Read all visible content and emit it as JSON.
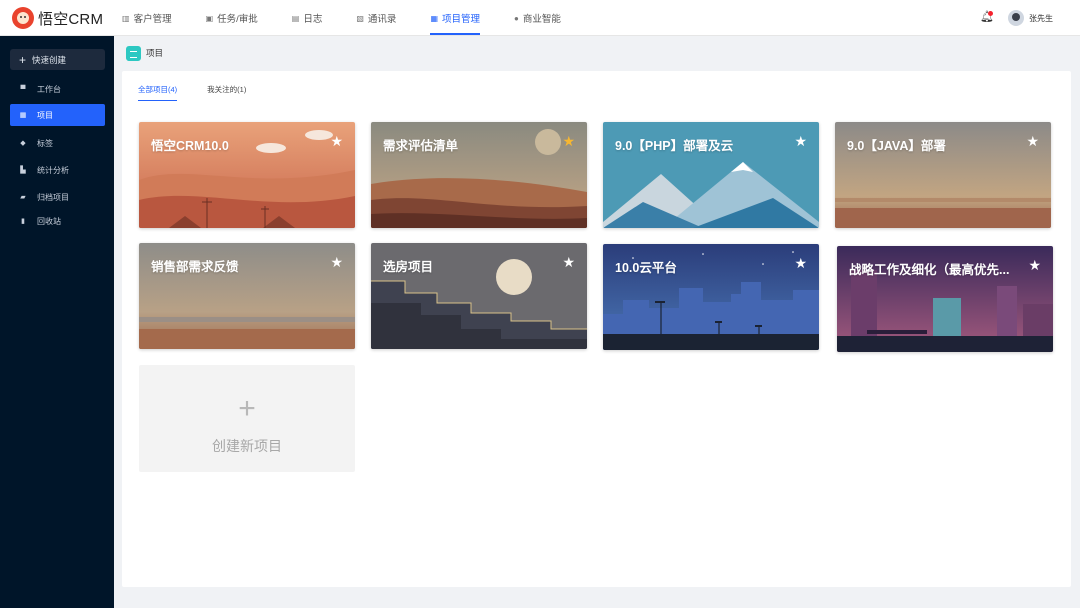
{
  "app": {
    "logo_text": "悟空CRM",
    "user_name": "张先生"
  },
  "nav": [
    {
      "label": "客户管理",
      "icon": "building-icon"
    },
    {
      "label": "任务/审批",
      "icon": "briefcase-icon"
    },
    {
      "label": "日志",
      "icon": "log-icon"
    },
    {
      "label": "通讯录",
      "icon": "contacts-icon"
    },
    {
      "label": "项目管理",
      "icon": "project-icon",
      "active": true
    },
    {
      "label": "商业智能",
      "icon": "bi-icon"
    }
  ],
  "sidebar": {
    "quick_create": "快速创建",
    "items": [
      {
        "label": "工作台",
        "icon": "monitor-icon"
      },
      {
        "label": "项目",
        "icon": "project-icon",
        "active": true
      },
      {
        "label": "标签",
        "icon": "tag-icon"
      },
      {
        "label": "统计分析",
        "icon": "chart-icon"
      },
      {
        "label": "归档项目",
        "icon": "archive-icon"
      },
      {
        "label": "回收站",
        "icon": "trash-icon"
      }
    ]
  },
  "breadcrumb": {
    "title": "项目"
  },
  "tabs": [
    {
      "label": "全部项目(4)",
      "active": true
    },
    {
      "label": "我关注的(1)"
    }
  ],
  "projects": [
    {
      "title": "悟空CRM10.0",
      "starred": false
    },
    {
      "title": "需求评估清单",
      "starred": true
    },
    {
      "title": "9.0【PHP】部署及云",
      "starred": false
    },
    {
      "title": "9.0【JAVA】部署",
      "starred": false
    },
    {
      "title": "销售部需求反馈",
      "starred": false
    },
    {
      "title": "选房项目",
      "starred": false
    },
    {
      "title": "10.0云平台",
      "starred": false
    },
    {
      "title": "战略工作及细化（最高优先...",
      "starred": false
    }
  ],
  "create_card": {
    "plus": "+",
    "label": "创建新项目"
  },
  "colors": {
    "accent": "#2362fb",
    "sidebar_bg": "#001529",
    "star_on": "#f7b731"
  }
}
